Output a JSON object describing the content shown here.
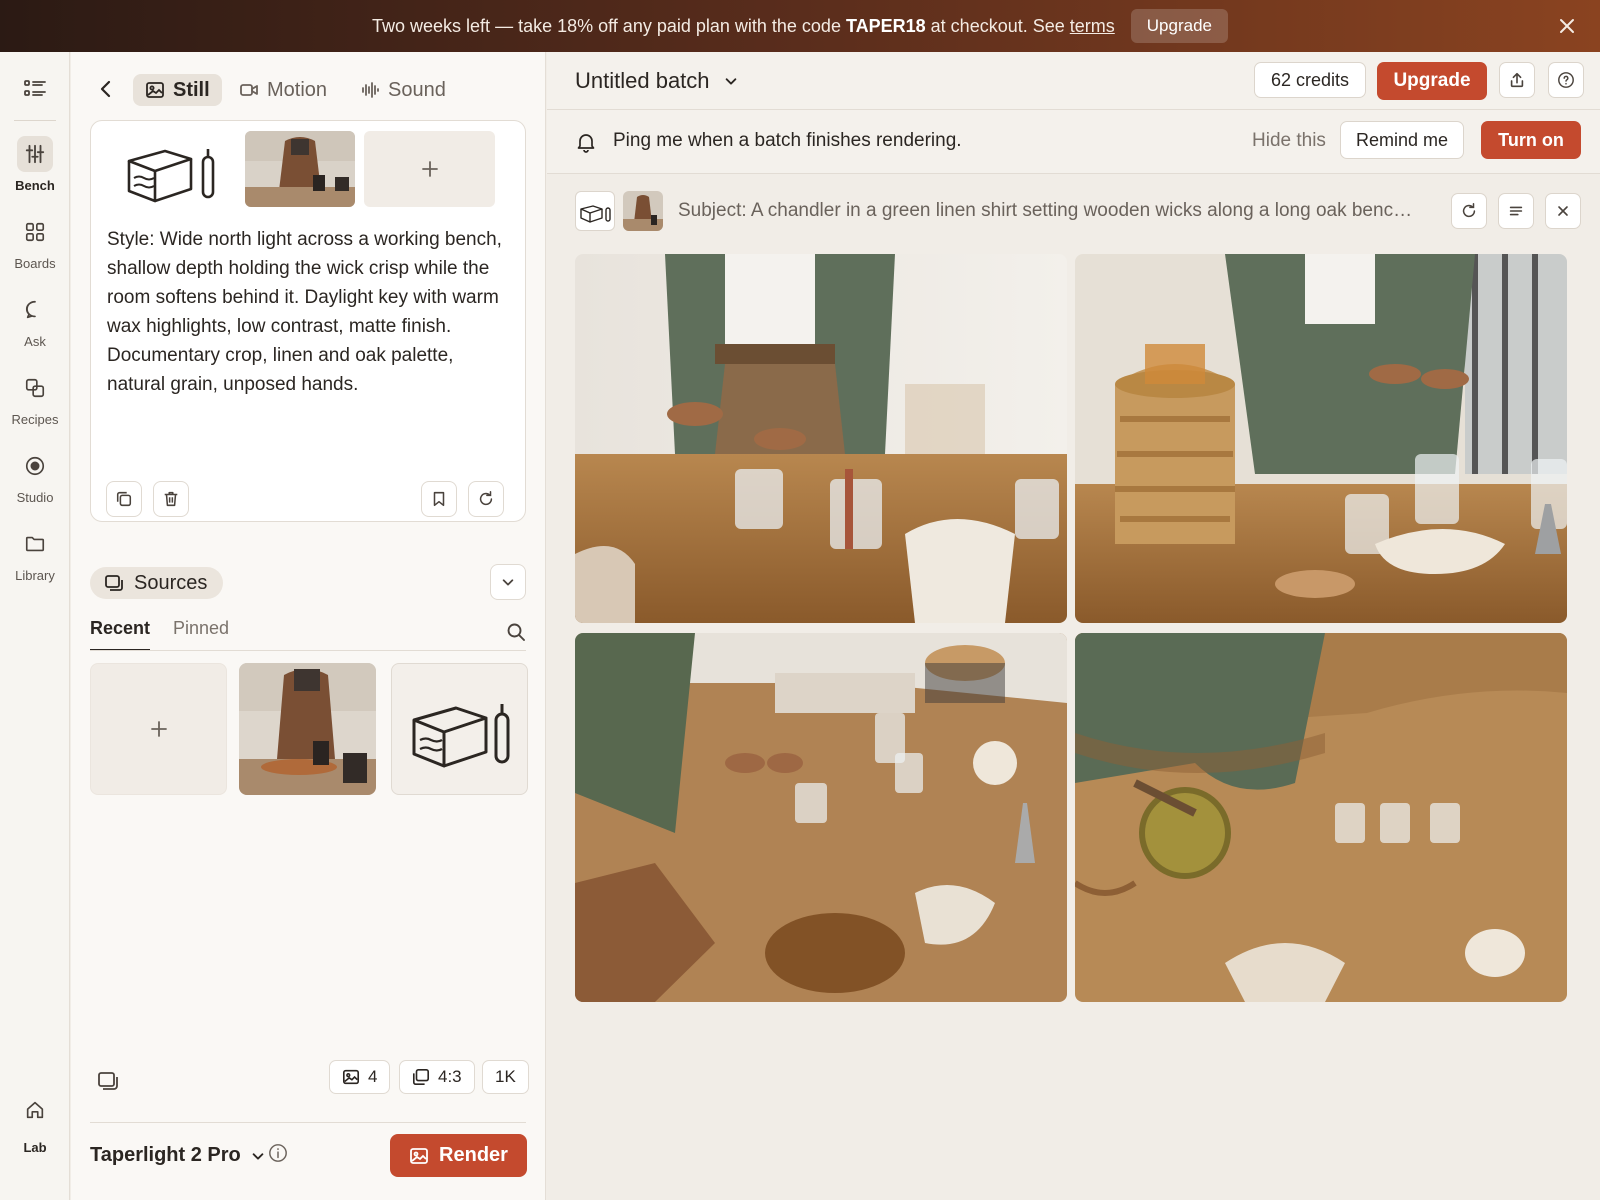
{
  "promo": {
    "text_before": "Two weeks left — take 18% off any paid plan with the code ",
    "code": "TAPER18",
    "text_after": " at checkout. See ",
    "terms_link": "terms",
    "upgrade_label": "Upgrade"
  },
  "rail": {
    "items": [
      {
        "label": "Bench",
        "icon": "sliders-icon",
        "active": true
      },
      {
        "label": "Boards",
        "icon": "grid-icon"
      },
      {
        "label": "Ask",
        "icon": "chat-icon"
      },
      {
        "label": "Recipes",
        "icon": "recipes-icon"
      },
      {
        "label": "Studio",
        "icon": "target-icon"
      },
      {
        "label": "Library",
        "icon": "folder-icon"
      }
    ],
    "bottom_label": "Lab"
  },
  "panel": {
    "tabs": [
      {
        "label": "Still",
        "icon": "image-icon",
        "active": true
      },
      {
        "label": "Motion",
        "icon": "video-icon"
      },
      {
        "label": "Sound",
        "icon": "waveform-icon"
      }
    ],
    "style_text": "Style: Wide north light across a working bench, shallow depth holding the wick crisp while the room softens behind it. Daylight key with warm wax highlights, low contrast, matte finish. Documentary crop, linen and oak palette, natural grain, unposed hands.",
    "sources_label": "Sources",
    "source_tabs": [
      {
        "label": "Recent",
        "active": true
      },
      {
        "label": "Pinned"
      }
    ],
    "options": {
      "count": "4",
      "aspect": "4:3",
      "resolution": "1K"
    },
    "model": "Taperlight 2 Pro",
    "render_label": "Render"
  },
  "main": {
    "batch_title": "Untitled batch",
    "credits": "62 credits",
    "upgrade_label": "Upgrade",
    "notice_text": "Ping me when a batch finishes rendering.",
    "hide_label": "Hide this",
    "remind_label": "Remind me",
    "turn_on_label": "Turn on",
    "subject_text": "Subject: A chandler in a green linen shirt setting wooden wicks along a long oak bench…"
  },
  "colors": {
    "accent": "#c44a2e",
    "banner_dark": "#2b1a14",
    "banner_warm": "#8a4320",
    "panel_bg": "#faf8f5",
    "main_bg": "#f1ede7"
  }
}
